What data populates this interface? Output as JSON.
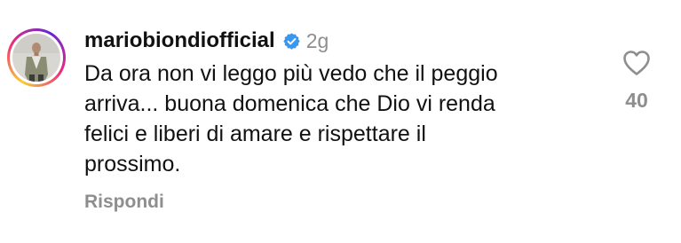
{
  "comment": {
    "username": "mariobiondiofficial",
    "verified_icon": "verified-badge-icon",
    "time": "2g",
    "text_lines": [
      "Da ora non vi leggo più vedo che il peggio",
      "arriva... buona domenica che Dio vi renda",
      "felici e liberi di amare e rispettare il",
      "prossimo."
    ],
    "reply_label": "Rispondi",
    "like_icon": "heart-outline-icon",
    "like_count": "40"
  },
  "colors": {
    "text": "#111111",
    "muted": "#8e8e8e",
    "verified_blue": "#3897f0",
    "background": "#ffffff"
  }
}
